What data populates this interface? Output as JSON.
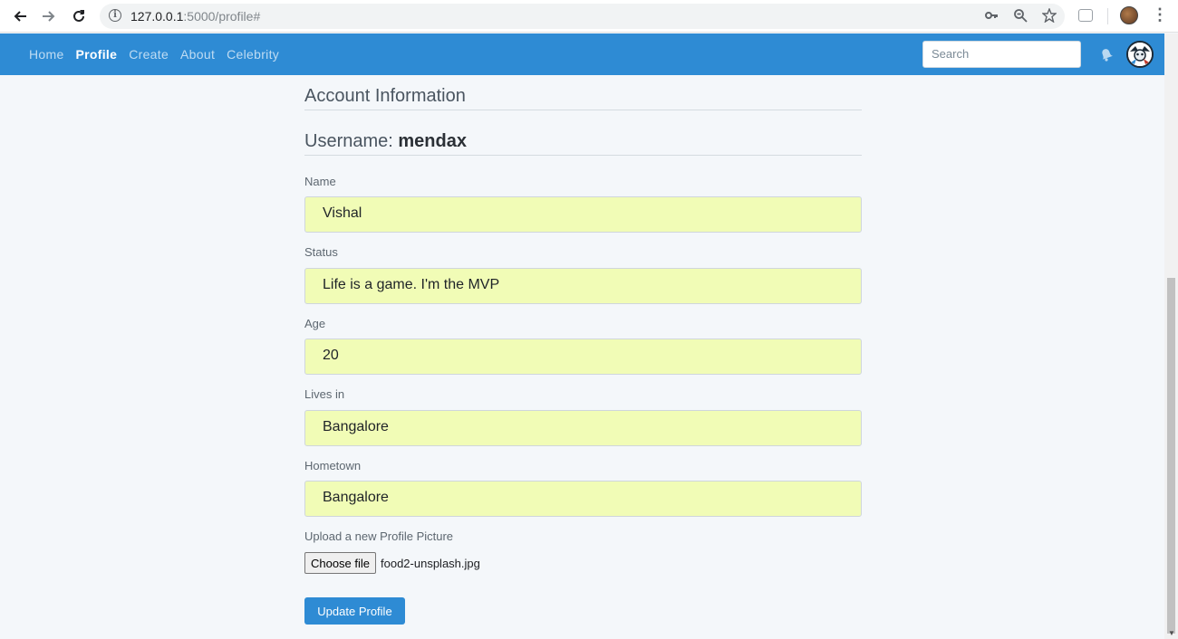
{
  "browser": {
    "url_host": "127.0.0.1",
    "url_rest": ":5000/profile#"
  },
  "navbar": {
    "links": [
      {
        "label": "Home",
        "active": false
      },
      {
        "label": "Profile",
        "active": true
      },
      {
        "label": "Create",
        "active": false
      },
      {
        "label": "About",
        "active": false
      },
      {
        "label": "Celebrity",
        "active": false
      }
    ],
    "search_placeholder": "Search"
  },
  "main": {
    "section_title": "Account Information",
    "username_label": "Username:",
    "username_value": "mendax",
    "fields": [
      {
        "label": "Name",
        "value": "Vishal"
      },
      {
        "label": "Status",
        "value": "Life is a game. I'm the MVP"
      },
      {
        "label": "Age",
        "value": "20"
      },
      {
        "label": "Lives in",
        "value": "Bangalore"
      },
      {
        "label": "Hometown",
        "value": "Bangalore"
      }
    ],
    "upload_label": "Upload a new Profile Picture",
    "choose_file_label": "Choose file",
    "file_name": "food2-unsplash.jpg",
    "submit_label": "Update Profile"
  },
  "colors": {
    "navbar": "#2e8bd4",
    "input_bg": "#f1fcb6",
    "page_bg": "#f4f7fa"
  }
}
